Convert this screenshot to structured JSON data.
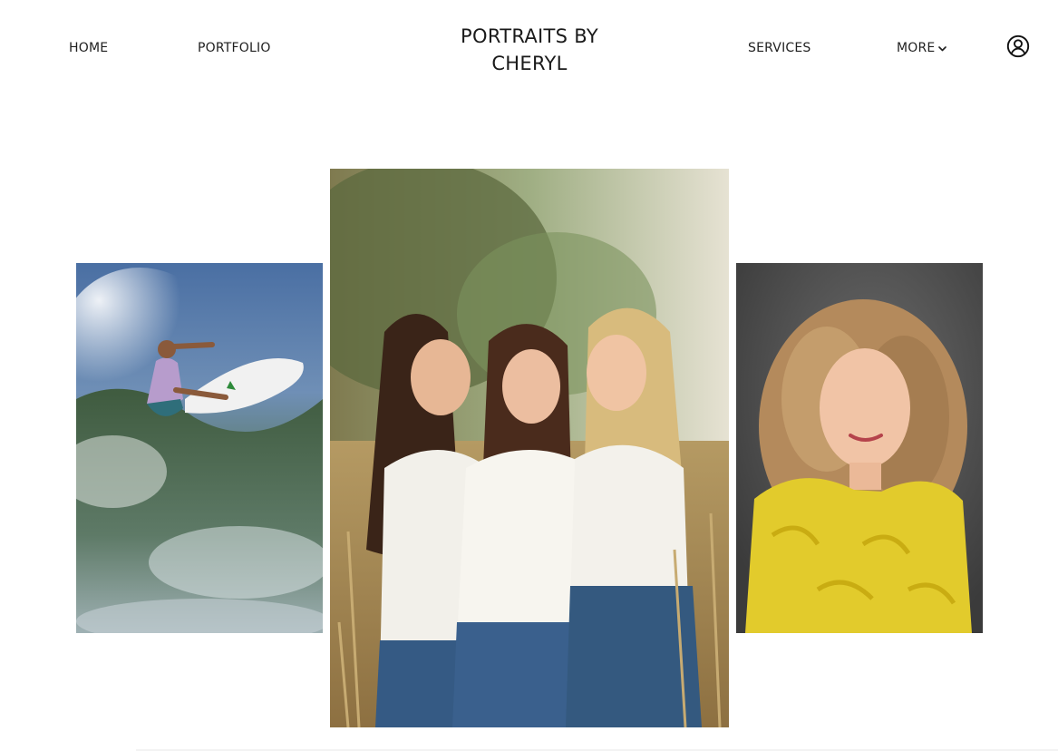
{
  "nav": {
    "home": "HOME",
    "portfolio": "PORTFOLIO",
    "services": "SERVICES",
    "more": "MORE"
  },
  "site_title": {
    "line1": "PORTRAITS BY",
    "line2": "CHERYL"
  },
  "icons": {
    "account": "user-circle-icon",
    "more_caret": "chevron-down-icon"
  },
  "gallery": {
    "photos": [
      {
        "name": "surfer-photo",
        "subject": "surfer on wave"
      },
      {
        "name": "three-women-photo",
        "subject": "three women in field"
      },
      {
        "name": "woman-yellow-top-photo",
        "subject": "woman in yellow top"
      }
    ]
  },
  "colors": {
    "background": "#ffffff",
    "text": "#1f1f1f"
  }
}
